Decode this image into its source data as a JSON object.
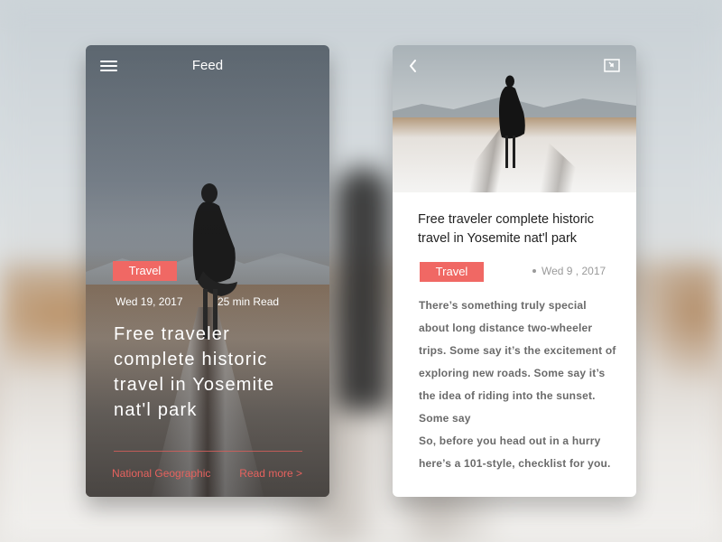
{
  "colors": {
    "accent": "#f06864",
    "accent_text": "#e7625e",
    "title_text": "#222222",
    "body_text": "#6a6a6a",
    "muted_text": "#9a9a9a"
  },
  "feed_card": {
    "header": {
      "title": "Feed",
      "menu_icon": "hamburger-menu-icon"
    },
    "tag": "Travel",
    "date": "Wed 19, 2017",
    "read_time": "25 min Read",
    "headline": "Free traveler complete historic travel in Yosemite nat'l park",
    "source": "National Geographic",
    "read_more": "Read more >"
  },
  "article_card": {
    "back_icon": "chevron-left-icon",
    "share_icon": "share-box-icon",
    "title": "Free traveler complete historic travel in Yosemite nat'l park",
    "tag": "Travel",
    "date": "Wed 9 , 2017",
    "body": [
      "There’s something truly special about long distance two-wheeler trips. Some say it’s the excitement of exploring new roads. Some say it’s the idea of riding into the sunset. Some say",
      "So, before you head out in a hurry here’s a 101-style, checklist for you."
    ]
  }
}
